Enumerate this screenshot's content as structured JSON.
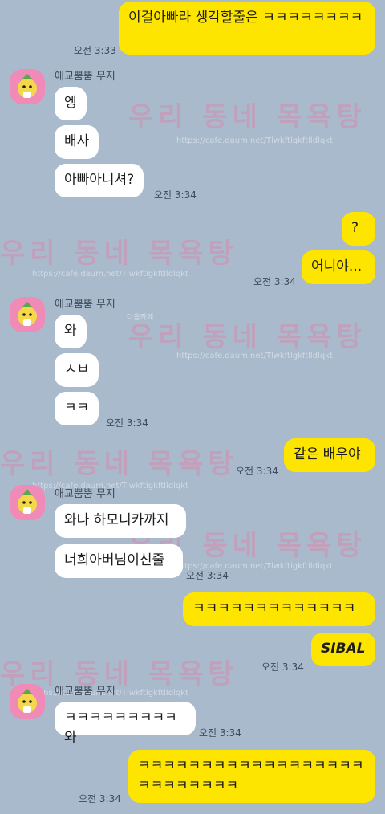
{
  "contact": {
    "name": "애교뿜뿜 무지",
    "avatar_icon": "muzi-avatar-icon"
  },
  "colors": {
    "background": "#a9bacd",
    "my_bubble": "#fee500",
    "their_bubble": "#ffffff"
  },
  "watermark": {
    "title": "우리 동네 목욕탕",
    "url": "https://cafe.daum.net/Tlwkftlgkftlldlqkt",
    "small": "다음카페"
  },
  "messages": [
    {
      "from": "me",
      "text": "이걸아빠라 생각할줄은 ㅋㅋㅋㅋㅋㅋㅋㅋ",
      "time": "오전 3:33"
    },
    {
      "from": "them",
      "text": "엥"
    },
    {
      "from": "them",
      "text": "배사"
    },
    {
      "from": "them",
      "text": "아빠아니셔?",
      "time": "오전 3:34"
    },
    {
      "from": "me",
      "text": "?"
    },
    {
      "from": "me",
      "text": "어니야...",
      "time": "오전 3:34"
    },
    {
      "from": "them",
      "text": "와"
    },
    {
      "from": "them",
      "text": "ㅅㅂ"
    },
    {
      "from": "them",
      "text": "ㅋㅋ",
      "time": "오전 3:34"
    },
    {
      "from": "me",
      "text": "같은 배우야",
      "time": "오전 3:34"
    },
    {
      "from": "them",
      "text": "와나 하모니카까지"
    },
    {
      "from": "them",
      "text": "너희아버님이신줄",
      "time": "오전 3:34"
    },
    {
      "from": "me",
      "text": "ㅋㅋㅋㅋㅋㅋㅋㅋㅋㅋㅋㅋㅋ"
    },
    {
      "from": "me",
      "text": "SIBAL",
      "time": "오전 3:34"
    },
    {
      "from": "them",
      "text": "ㅋㅋㅋㅋㅋㅋㅋㅋㅋ와",
      "time": "오전 3:34"
    },
    {
      "from": "me",
      "text": "ㅋㅋㅋㅋㅋㅋㅋㅋㅋㅋㅋㅋㅋㅋㅋㅋㅋㅋㅋㅋㅋㅋㅋㅋㅋㅋ",
      "time": "오전 3:34"
    }
  ]
}
